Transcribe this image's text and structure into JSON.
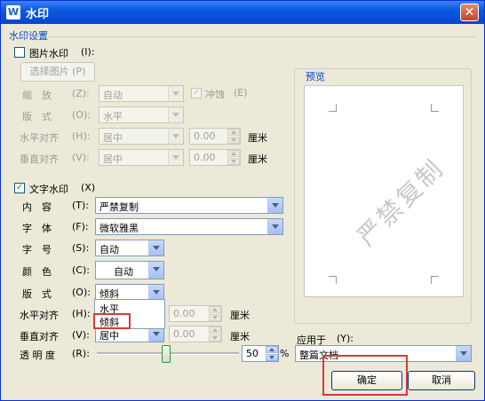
{
  "window": {
    "title": "水印",
    "title_icon": "W",
    "close": "✕"
  },
  "group_title": "水印设置",
  "picture": {
    "checkbox_label": "图片水印",
    "checkbox_key": "(I):",
    "select_button": "选择图片",
    "select_key": "(P)",
    "zoom_label": "缩　放",
    "zoom_key": "(Z):",
    "zoom_value": "自动",
    "washout_label": "冲蚀",
    "washout_key": "(E)",
    "layout_label": "版　式",
    "layout_key": "(O):",
    "layout_value": "水平",
    "halign_label": "水平对齐",
    "halign_key": "(H):",
    "halign_value": "居中",
    "halign_offset": "0.00",
    "valign_label": "垂直对齐",
    "valign_key": "(V):",
    "valign_value": "居中",
    "valign_offset": "0.00",
    "unit": "厘米"
  },
  "text": {
    "checkbox_label": "文字水印",
    "checkbox_key": "(X)",
    "content_label": "内　容",
    "content_key": "(T):",
    "content_value": "严禁复制",
    "font_label": "字　体",
    "font_key": "(F):",
    "font_value": "微软雅黑",
    "size_label": "字　号",
    "size_key": "(S):",
    "size_value": "自动",
    "color_label": "颜　色",
    "color_key": "(C):",
    "color_value": "自动",
    "layout_label": "版　式",
    "layout_key": "(O):",
    "layout_value": "倾斜",
    "layout_options": [
      "水平",
      "倾斜"
    ],
    "halign_label": "水平对齐",
    "halign_key": "(H):",
    "halign_offset": "0.00",
    "valign_label": "垂直对齐",
    "valign_key": "(V):",
    "valign_value": "居中",
    "valign_offset": "0.00",
    "unit": "厘米",
    "transparency_label": "透 明 度",
    "transparency_key": "(R):",
    "transparency_value": "50",
    "transparency_unit": "%"
  },
  "preview": {
    "label": "预览",
    "watermark_text": "严禁复制"
  },
  "apply": {
    "label": "应用于",
    "key": "(Y):",
    "value": "整篇文档"
  },
  "buttons": {
    "ok": "确定",
    "cancel": "取消"
  },
  "colors": {
    "title_bar": "#0a5ae0",
    "highlight_box": "#d83a3a",
    "dialog_bg": "#ece9d8"
  }
}
